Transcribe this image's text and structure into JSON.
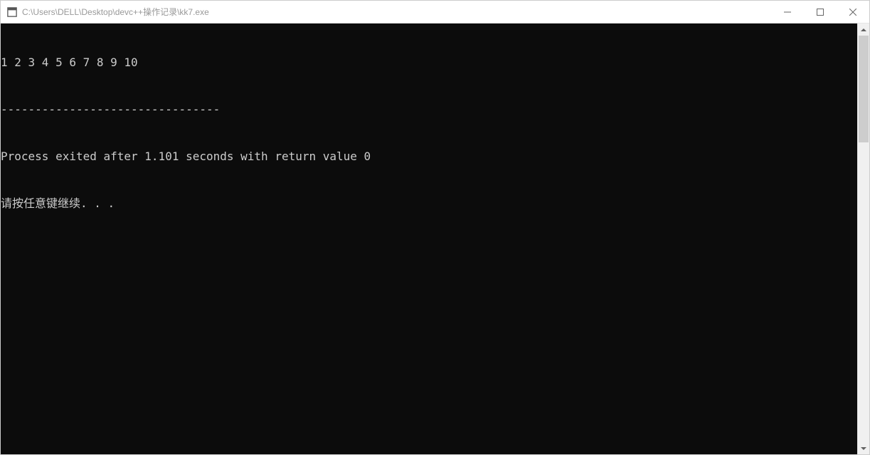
{
  "window": {
    "title": "C:\\Users\\DELL\\Desktop\\devc++操作记录\\kk7.exe"
  },
  "console": {
    "lines": [
      "1 2 3 4 5 6 7 8 9 10",
      "--------------------------------",
      "Process exited after 1.101 seconds with return value 0",
      "请按任意键继续. . ."
    ]
  }
}
